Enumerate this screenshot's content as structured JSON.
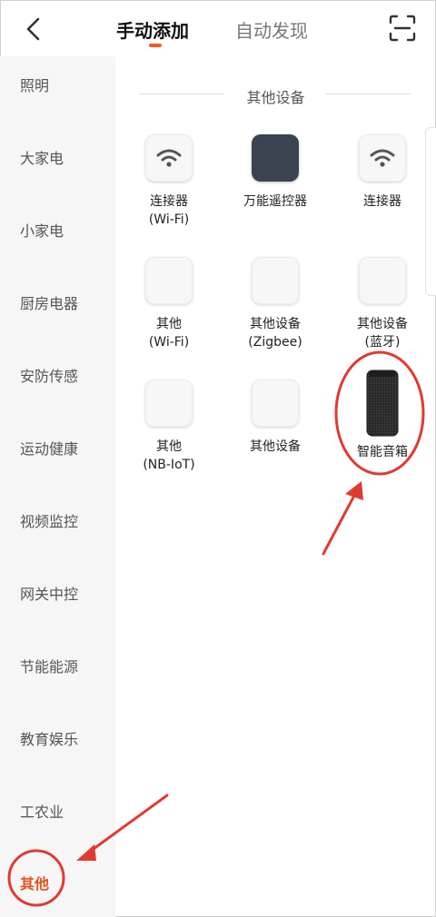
{
  "header": {
    "tabs": [
      {
        "label": "手动添加",
        "active": true
      },
      {
        "label": "自动发现",
        "active": false
      }
    ],
    "back_icon": "chevron-left-icon",
    "scan_icon": "scan-icon",
    "accent_color": "#f25a22"
  },
  "sidebar": {
    "items": [
      {
        "label": "照明"
      },
      {
        "label": "大家电"
      },
      {
        "label": "小家电"
      },
      {
        "label": "厨房电器"
      },
      {
        "label": "安防传感"
      },
      {
        "label": "运动健康"
      },
      {
        "label": "视频监控"
      },
      {
        "label": "网关中控"
      },
      {
        "label": "节能能源"
      },
      {
        "label": "教育娱乐"
      },
      {
        "label": "工农业"
      },
      {
        "label": "其他",
        "active": true
      }
    ]
  },
  "section": {
    "title": "其他设备"
  },
  "devices": [
    {
      "line1": "连接器",
      "line2": "(Wi-Fi)",
      "icon": "wifi-icon"
    },
    {
      "line1": "万能遥控器",
      "line2": "",
      "icon": "remote-control-icon"
    },
    {
      "line1": "连接器",
      "line2": "",
      "icon": "wifi-icon"
    },
    {
      "line1": "其他",
      "line2": "(Wi-Fi)",
      "icon": "blank-device-icon"
    },
    {
      "line1": "其他设备",
      "line2": "(Zigbee)",
      "icon": "blank-device-icon"
    },
    {
      "line1": "其他设备",
      "line2": "(蓝牙)",
      "icon": "blank-device-icon"
    },
    {
      "line1": "其他",
      "line2": "(NB-IoT)",
      "icon": "blank-device-icon"
    },
    {
      "line1": "其他设备",
      "line2": "",
      "icon": "blank-device-icon"
    },
    {
      "line1": "智能音箱",
      "line2": "",
      "icon": "smart-speaker-icon"
    }
  ],
  "annotation_color": "#e03a32"
}
